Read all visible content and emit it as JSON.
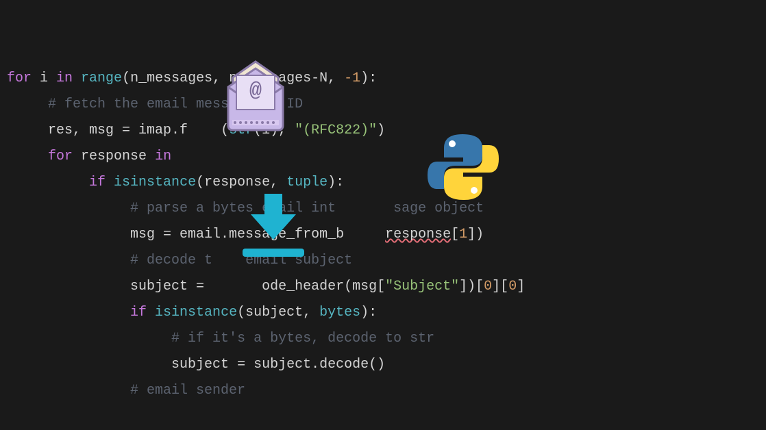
{
  "code": {
    "lines": [
      {
        "indent": 0,
        "tokens": [
          {
            "t": "for ",
            "c": "kw-for"
          },
          {
            "t": "i ",
            "c": "var"
          },
          {
            "t": "in ",
            "c": "kw-in"
          },
          {
            "t": "range",
            "c": "builtin"
          },
          {
            "t": "(n_messages, n_messages-N, ",
            "c": "var"
          },
          {
            "t": "-1",
            "c": "num"
          },
          {
            "t": "):",
            "c": "var"
          }
        ]
      },
      {
        "indent": 1,
        "tokens": [
          {
            "t": "# fetch the email message by ID",
            "c": "comment"
          }
        ]
      },
      {
        "indent": 1,
        "tokens": [
          {
            "t": "res, msg = imap.f",
            "c": "var"
          },
          {
            "t": "    ",
            "c": "var"
          },
          {
            "t": "(",
            "c": "var"
          },
          {
            "t": "str",
            "c": "builtin"
          },
          {
            "t": "(i), ",
            "c": "var"
          },
          {
            "t": "\"(RFC822)\"",
            "c": "string"
          },
          {
            "t": ")",
            "c": "var"
          }
        ]
      },
      {
        "indent": 1,
        "tokens": [
          {
            "t": "for ",
            "c": "kw-for"
          },
          {
            "t": "response ",
            "c": "var"
          },
          {
            "t": "in",
            "c": "kw-in"
          }
        ]
      },
      {
        "indent": 2,
        "tokens": [
          {
            "t": "if ",
            "c": "kw-if"
          },
          {
            "t": "isinstance",
            "c": "builtin"
          },
          {
            "t": "(response, ",
            "c": "var"
          },
          {
            "t": "tuple",
            "c": "builtin"
          },
          {
            "t": "):",
            "c": "var"
          }
        ]
      },
      {
        "indent": 3,
        "tokens": [
          {
            "t": "# parse a bytes email int",
            "c": "comment"
          },
          {
            "t": "       ",
            "c": "comment"
          },
          {
            "t": "sage object",
            "c": "comment"
          }
        ]
      },
      {
        "indent": 3,
        "tokens": [
          {
            "t": "msg = email.message_from_b",
            "c": "var"
          },
          {
            "t": "     ",
            "c": "var"
          },
          {
            "t": "response",
            "c": "var",
            "squiggly": true
          },
          {
            "t": "[",
            "c": "var"
          },
          {
            "t": "1",
            "c": "num"
          },
          {
            "t": "])",
            "c": "var"
          }
        ]
      },
      {
        "indent": 3,
        "tokens": [
          {
            "t": "# decode t",
            "c": "comment"
          },
          {
            "t": "    ",
            "c": "comment"
          },
          {
            "t": "email subject",
            "c": "comment"
          }
        ]
      },
      {
        "indent": 3,
        "tokens": [
          {
            "t": "subject = ",
            "c": "var"
          },
          {
            "t": "      ",
            "c": "var"
          },
          {
            "t": "ode_header(msg[",
            "c": "var"
          },
          {
            "t": "\"Subject\"",
            "c": "string"
          },
          {
            "t": "])[",
            "c": "var"
          },
          {
            "t": "0",
            "c": "num"
          },
          {
            "t": "][",
            "c": "var"
          },
          {
            "t": "0",
            "c": "num"
          },
          {
            "t": "]",
            "c": "var"
          }
        ]
      },
      {
        "indent": 3,
        "tokens": [
          {
            "t": "if ",
            "c": "kw-if"
          },
          {
            "t": "isinstance",
            "c": "builtin"
          },
          {
            "t": "(subject, ",
            "c": "var"
          },
          {
            "t": "bytes",
            "c": "builtin"
          },
          {
            "t": "):",
            "c": "var"
          }
        ]
      },
      {
        "indent": 4,
        "tokens": [
          {
            "t": "# if it's a bytes, decode to str",
            "c": "comment"
          }
        ]
      },
      {
        "indent": 4,
        "tokens": [
          {
            "t": "subject = subject.decode()",
            "c": "var"
          }
        ]
      },
      {
        "indent": 3,
        "tokens": [
          {
            "t": "# email sender",
            "c": "comment"
          }
        ]
      }
    ]
  },
  "icons": {
    "email": "email-at-icon",
    "python": "python-logo-icon",
    "download": "download-arrow-icon"
  }
}
